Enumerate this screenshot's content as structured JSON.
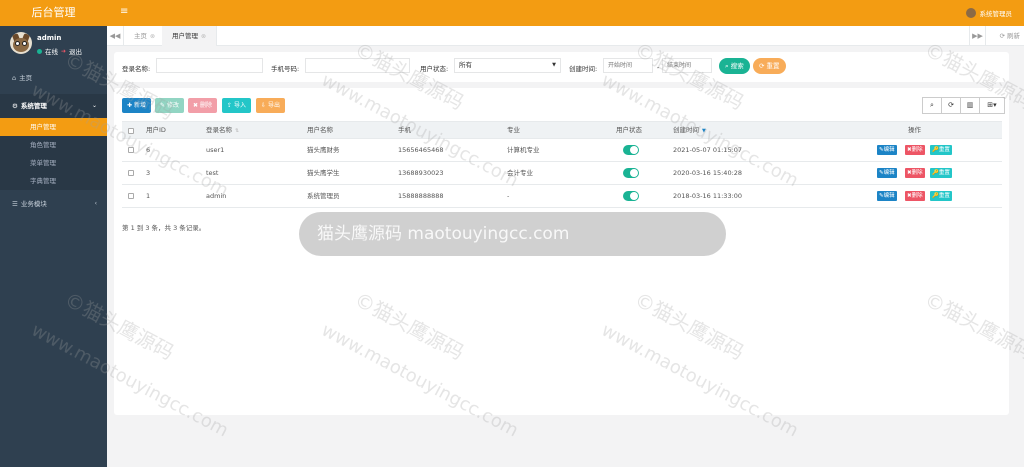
{
  "app": {
    "title": "后台管理"
  },
  "user": {
    "name": "admin",
    "status": "在线",
    "logout": "退出"
  },
  "sidebar": {
    "items": [
      {
        "label": "主页"
      },
      {
        "label": "系统管理",
        "children": [
          {
            "label": "用户管理",
            "active": true
          },
          {
            "label": "角色管理"
          },
          {
            "label": "菜单管理"
          },
          {
            "label": "字典管理"
          }
        ]
      },
      {
        "label": "业务模块"
      }
    ]
  },
  "topbar": {
    "menu_icon": "≡",
    "user_label": "系统管理员"
  },
  "tabs": {
    "items": [
      {
        "label": "主页"
      },
      {
        "label": "用户管理"
      }
    ],
    "refresh": "刷新"
  },
  "search": {
    "login_name_label": "登录名称:",
    "phone_label": "手机号码:",
    "status_label": "用户状态:",
    "status_value": "所有",
    "created_label": "创建时间:",
    "start_placeholder": "开始时间",
    "range_sep": "-",
    "end_placeholder": "结束时间",
    "search_btn": "搜索",
    "reset_btn": "重置"
  },
  "toolbar": {
    "add": "新增",
    "edit": "修改",
    "delete": "删除",
    "import": "导入",
    "export": "导出"
  },
  "table": {
    "headers": [
      "用户ID",
      "登录名称",
      "用户名称",
      "手机",
      "专业",
      "用户状态",
      "创建时间",
      "操作"
    ],
    "rows": [
      {
        "id": "6",
        "login": "user1",
        "name": "猫头鹰财务",
        "phone": "15656465468",
        "major": "计算机专业",
        "created": "2021-05-07 01:15:07"
      },
      {
        "id": "3",
        "login": "test",
        "name": "猫头鹰学生",
        "phone": "13688930023",
        "major": "会计专业",
        "created": "2020-03-16 15:40:28"
      },
      {
        "id": "1",
        "login": "admin",
        "name": "系统管理员",
        "phone": "15888888888",
        "major": "-",
        "created": "2018-03-16 11:33:00"
      }
    ],
    "actions": {
      "edit": "编辑",
      "delete": "删除",
      "reset": "重置"
    },
    "pager": "第 1 到 3 条，共 3 条记录。"
  },
  "watermark": {
    "banner": "猫头鹰源码  maotouyingcc.com",
    "text1": "©猫头鹰源码",
    "text2": "www.maotouyingcc.com"
  }
}
